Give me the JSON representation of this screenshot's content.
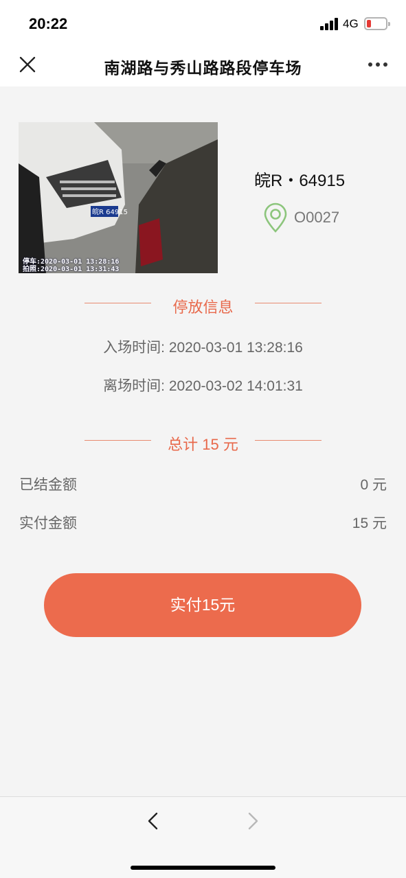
{
  "status_bar": {
    "time": "20:22",
    "network": "4G",
    "battery_color": "#e53935"
  },
  "nav": {
    "title": "南湖路与秀山路路段停车场",
    "close_icon": "close-icon",
    "more_icon": "more-dots-icon"
  },
  "vehicle": {
    "plate": "皖R・64915",
    "spot": "O0027",
    "photo_stamp_lines": [
      "停车:2020-03-01 13:28:16",
      "拍照:2020-03-01 13:31:43"
    ],
    "photo_plate_text": "皖R 64915"
  },
  "parking_info": {
    "section_title": "停放信息",
    "entry": "入场时间: 2020-03-01 13:28:16",
    "exit": "离场时间: 2020-03-02 14:01:31"
  },
  "total": {
    "section_title": "总计 15 元"
  },
  "amounts": [
    {
      "label": "已结金额",
      "value": "0 元"
    },
    {
      "label": "实付金额",
      "value": "15 元"
    }
  ],
  "pay_button": {
    "label": "实付15元"
  },
  "colors": {
    "accent": "#ec6b4d",
    "pin": "#8cc57c"
  }
}
